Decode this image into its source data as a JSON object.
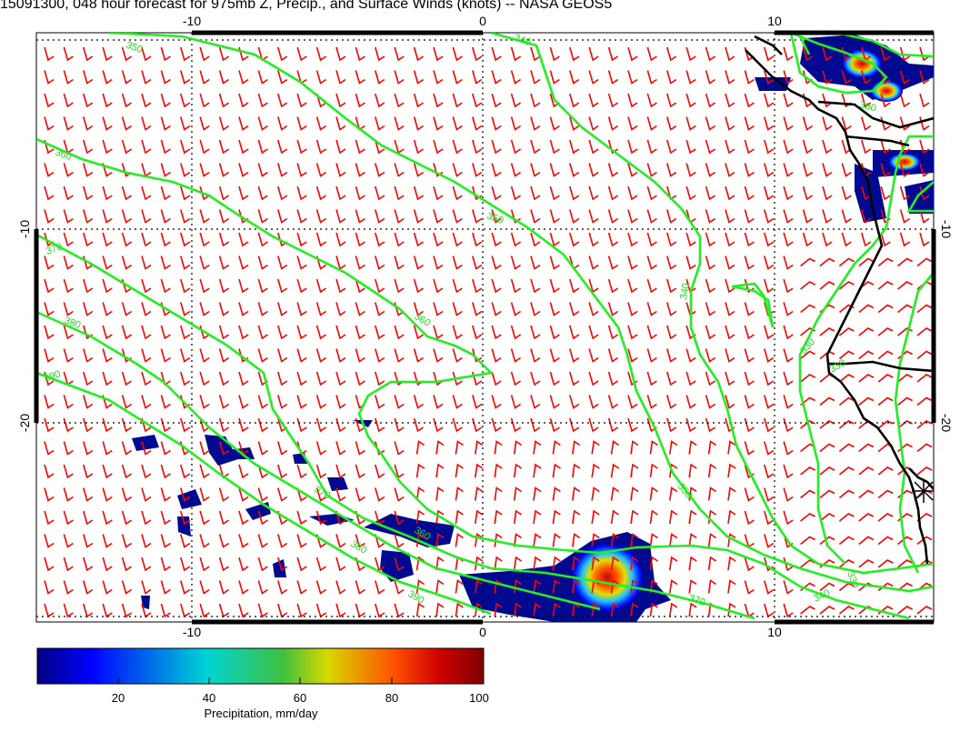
{
  "title": "15091300, 048 hour forecast for 975mb Z, Precip., and Surface Winds (knots) -- NASA GEOS5",
  "map": {
    "x_ticks": [
      "-10",
      "0",
      "10"
    ],
    "y_ticks": [
      "-10",
      "-20"
    ],
    "contour_labels": [
      "350",
      "340",
      "360",
      "350",
      "370",
      "340",
      "380",
      "360",
      "390",
      "360",
      "370",
      "380",
      "380",
      "390",
      "350",
      "370",
      "340",
      "330",
      "330",
      "330"
    ],
    "colors": {
      "wind_barbs": "#ff0000",
      "contours": "#22ee22",
      "coastline": "#000000",
      "precip_low": "#000080",
      "precip_high": "#800000"
    }
  },
  "colorbar": {
    "label": "Precipitation, mm/day",
    "ticks": [
      "20",
      "40",
      "60",
      "80",
      "100"
    ],
    "range": [
      0,
      100
    ]
  }
}
